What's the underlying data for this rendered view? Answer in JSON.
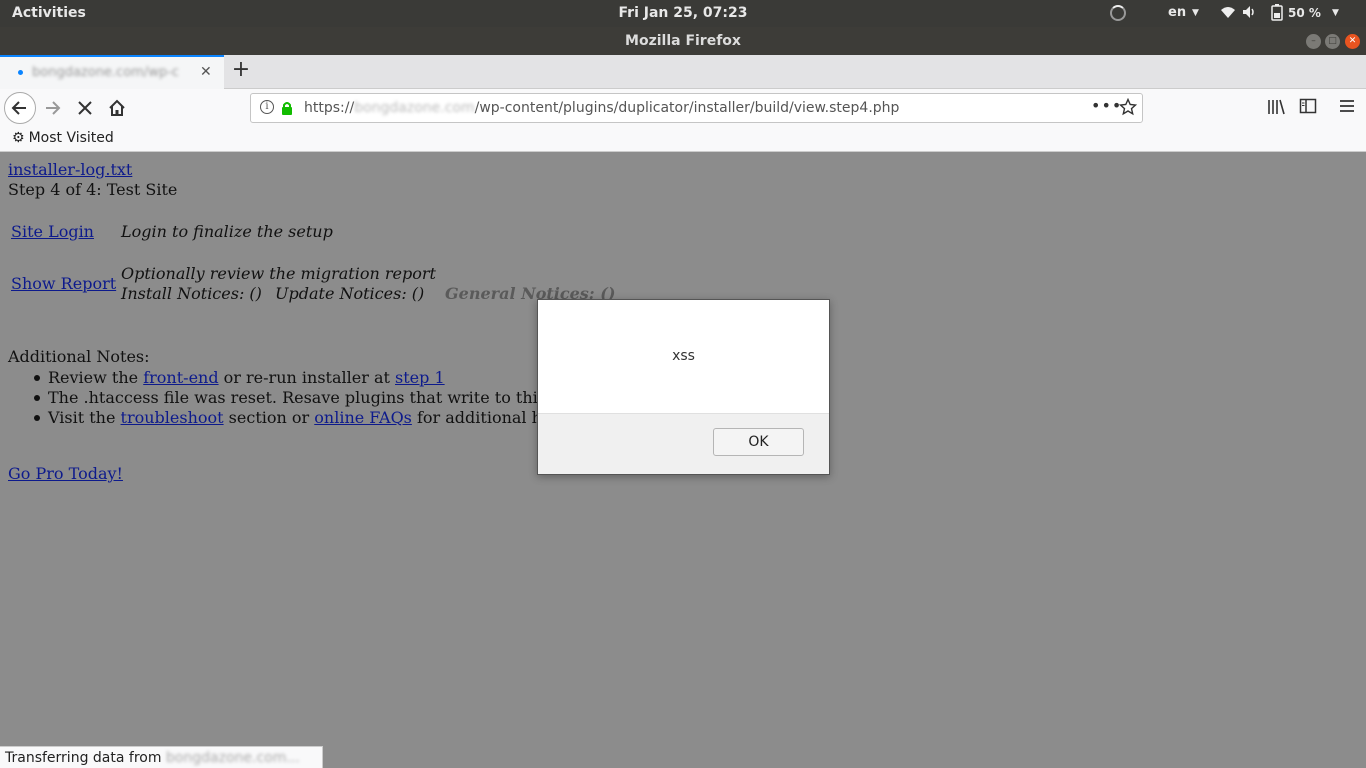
{
  "system_bar": {
    "activities": "Activities",
    "clock": "Fri Jan 25, 07:23",
    "language": "en",
    "battery_percent": "50 %"
  },
  "window": {
    "title": "Mozilla Firefox"
  },
  "tab": {
    "title": "bongdazone.com/wp-c"
  },
  "url_bar": {
    "scheme": "https://",
    "host": "bongdazone.com",
    "path": "/wp-content/plugins/duplicator/installer/build/view.step4.php"
  },
  "bookmarks": {
    "most_visited": "Most Visited"
  },
  "page": {
    "log_link": "installer-log.txt",
    "step_heading": "Step 4 of 4: Test Site",
    "site_login_link": "Site Login",
    "site_login_desc": "Login to finalize the setup",
    "show_report_link": "Show Report",
    "show_report_desc": "Optionally review the migration report",
    "install_notices": "Install Notices: ()",
    "update_notices": "Update Notices: ()",
    "general_notices": "General Notices: ()",
    "additional_notes_label": "Additional Notes:",
    "note1_prefix": "Review the ",
    "note1_link1": "front-end",
    "note1_middle": " or re-run installer at ",
    "note1_link2": "step 1",
    "note2_text": "The .htaccess file was reset. Resave plugins that write to this",
    "note3_prefix": "Visit the ",
    "note3_link1": "troubleshoot",
    "note3_middle": " section or ",
    "note3_link2": "online FAQs",
    "note3_suffix": " for additional h",
    "go_pro_link": "Go Pro Today!"
  },
  "alert": {
    "message": "xss",
    "ok_label": "OK"
  },
  "status_bar": {
    "prefix": "Transferring data from ",
    "host": "bongdazone.com..."
  }
}
